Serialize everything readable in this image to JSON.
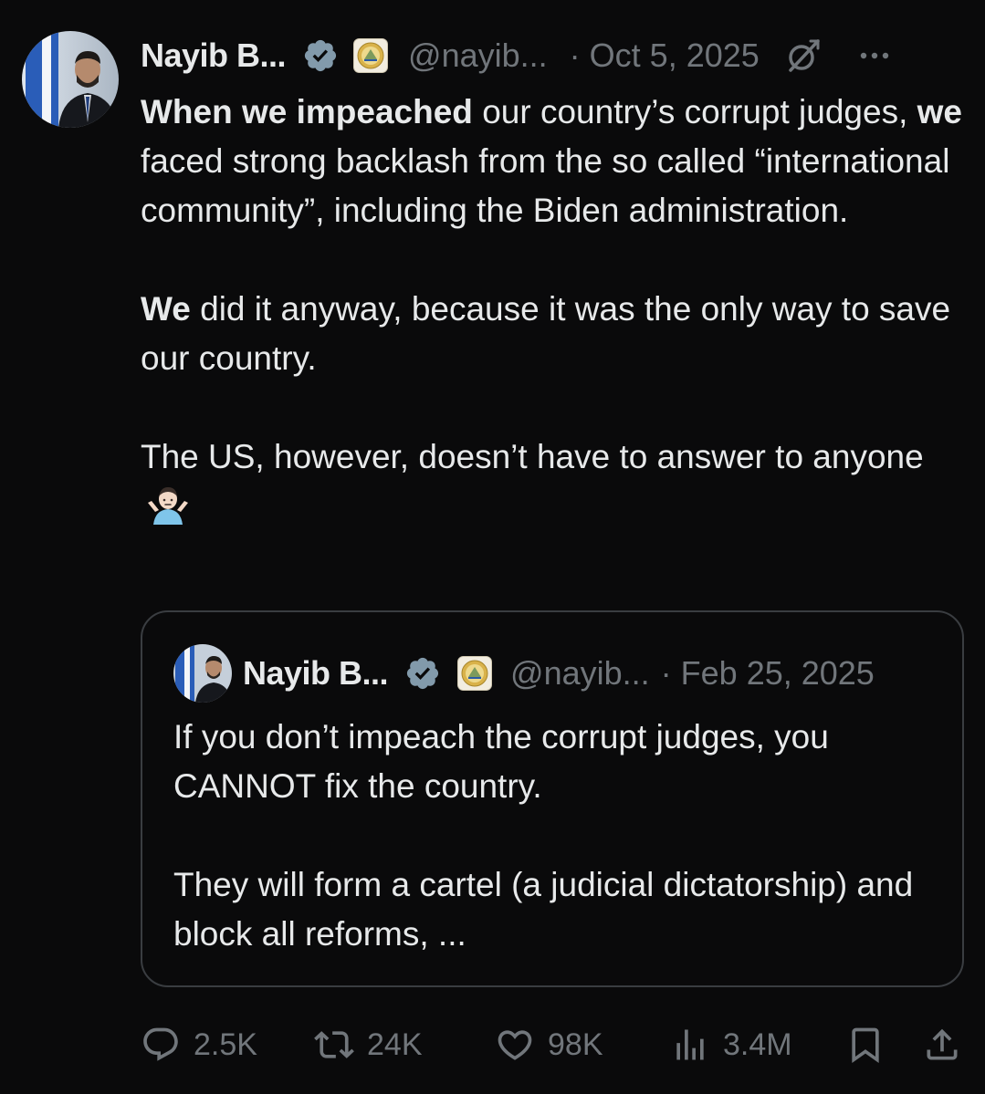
{
  "tweet": {
    "author": {
      "display_name": "Nayib B...",
      "handle": "@nayib...",
      "avatar_icon": "profile-photo",
      "verified_icon": "verified-badge-icon",
      "affiliation_icon": "government-seal-icon"
    },
    "date": "· Oct 5, 2025",
    "icons": {
      "grok": "grok-icon",
      "more": "more-icon"
    },
    "body": {
      "p1": {
        "s1": "When we impeached",
        "s2": " our country’s corrupt judges, ",
        "s3": "we",
        "s4": " faced strong backlash from the so called “international community”, including the Biden administration."
      },
      "p2": {
        "s1": "We",
        "s2": " did it anyway, because it was the only way to save our country."
      },
      "p3": {
        "s1": "The US, however, doesn’t have to answer to anyone",
        "emoji": "person-shrugging-emoji"
      }
    },
    "quoted": {
      "display_name": "Nayib B...",
      "handle": "@nayib...",
      "date": "· Feb 25, 2025",
      "p1": "If you don’t impeach the corrupt judges, you CANNOT fix the country.",
      "p2": "They will form a cartel (a judicial dictatorship) and block all reforms, ..."
    },
    "actions": {
      "replies": "2.5K",
      "reposts": "24K",
      "likes": "98K",
      "views": "3.4M",
      "icons": [
        "reply-icon",
        "repost-icon",
        "like-icon",
        "views-icon",
        "bookmark-icon",
        "share-icon"
      ]
    },
    "colors": {
      "background": "#0a0a0b",
      "text": "#e7e9ea",
      "muted": "#71767b",
      "verified_badge": "#829aab",
      "border": "#3a3d41"
    }
  }
}
